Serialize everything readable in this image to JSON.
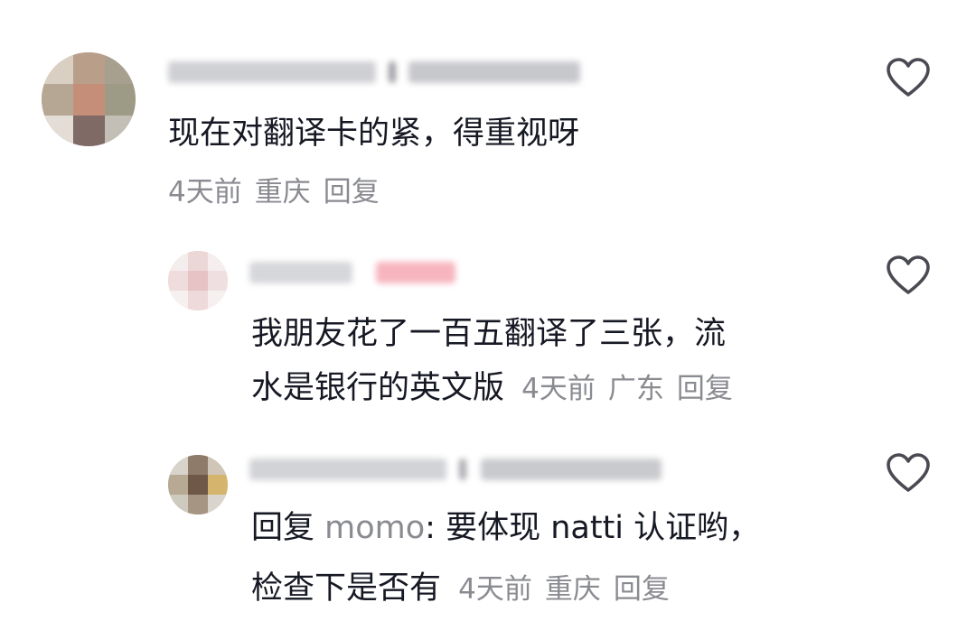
{
  "comments": [
    {
      "text": "现在对翻译卡的紧，得重视呀",
      "time": "4天前",
      "location": "重庆",
      "reply_label": "回复"
    },
    {
      "line1": "我朋友花了一百五翻译了三张，流",
      "line2": "水是银行的英文版",
      "time": "4天前",
      "location": "广东",
      "reply_label": "回复"
    },
    {
      "prefix": "回复",
      "mention": "momo",
      "line1_rest": ": 要体现 natti 认证哟，",
      "line2": "检查下是否有",
      "time": "4天前",
      "location": "重庆",
      "reply_label": "回复"
    }
  ],
  "icons": {
    "like": "heart-outline-icon"
  },
  "colors": {
    "text": "#161823",
    "meta": "#8a8b91",
    "icon": "#4a4b52"
  }
}
